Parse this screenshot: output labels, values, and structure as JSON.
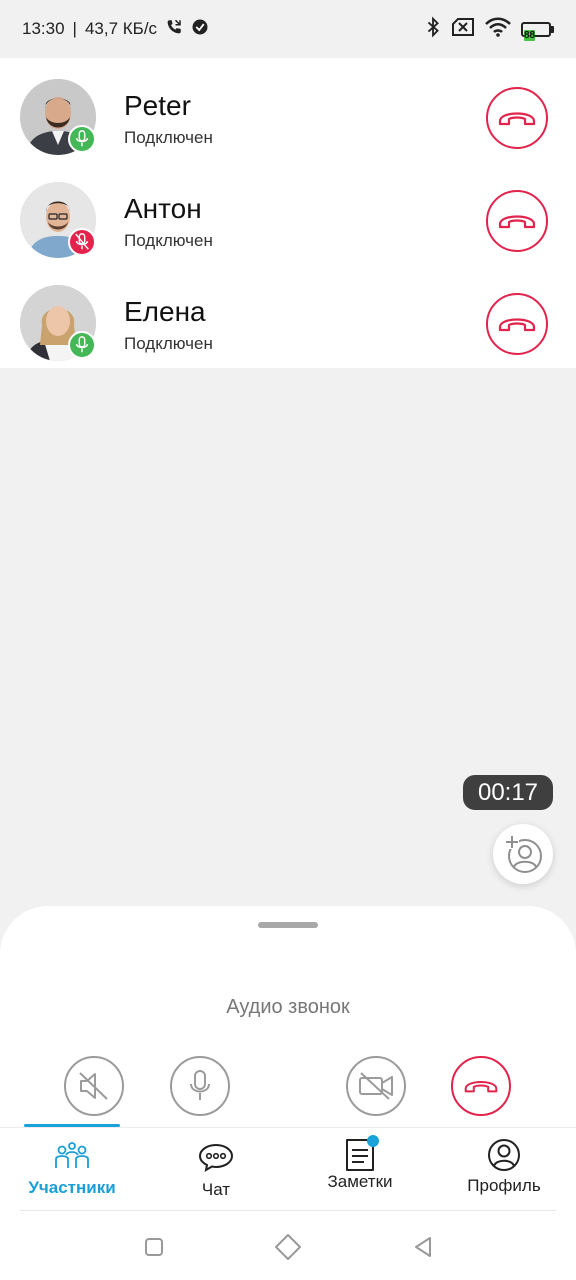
{
  "status_bar": {
    "time": "13:30",
    "network_speed": "43,7 КБ/с",
    "battery_level": "88",
    "icons": [
      "phone-call-icon",
      "check-circle-icon",
      "bluetooth-icon",
      "sim-blocked-icon",
      "wifi-icon",
      "battery-icon"
    ]
  },
  "participants": [
    {
      "name": "Peter",
      "status": "Подключен",
      "mic": "on"
    },
    {
      "name": "Антон",
      "status": "Подключен",
      "mic": "off"
    },
    {
      "name": "Елена",
      "status": "Подключен",
      "mic": "on"
    }
  ],
  "call": {
    "timer": "00:17",
    "title": "Аудио звонок",
    "controls": [
      "speaker-off-icon",
      "microphone-icon",
      "video-off-icon",
      "hangup-icon"
    ]
  },
  "tabs": [
    {
      "label": "Участники",
      "icon": "participants-icon",
      "active": true
    },
    {
      "label": "Чат",
      "icon": "chat-icon",
      "active": false
    },
    {
      "label": "Заметки",
      "icon": "notes-icon",
      "active": false,
      "badge": true
    },
    {
      "label": "Профиль",
      "icon": "profile-icon",
      "active": false
    }
  ],
  "colors": {
    "accent": "#1a9fd6",
    "hangup": "#e2234b",
    "mic_on": "#44b857",
    "mic_off": "#e2234b",
    "battery": "#48c145"
  }
}
